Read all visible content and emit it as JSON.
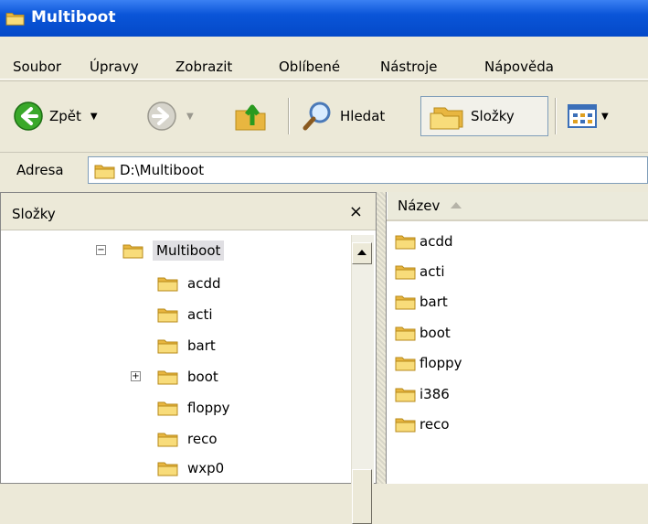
{
  "window": {
    "title": "Multiboot"
  },
  "menu": [
    {
      "label": "Soubor"
    },
    {
      "label": "Úpravy"
    },
    {
      "label": "Zobrazit"
    },
    {
      "label": "Oblíbené"
    },
    {
      "label": "Nástroje"
    },
    {
      "label": "Nápověda"
    }
  ],
  "toolbar": {
    "back_label": "Zpět",
    "search_label": "Hledat",
    "folders_label": "Složky"
  },
  "address": {
    "label": "Adresa",
    "value": "D:\\Multiboot"
  },
  "folders_pane": {
    "title": "Složky",
    "close": "×",
    "tree": [
      {
        "label": "Multiboot"
      },
      {
        "label": "acdd"
      },
      {
        "label": "acti"
      },
      {
        "label": "bart"
      },
      {
        "label": "boot"
      },
      {
        "label": "floppy"
      },
      {
        "label": "reco"
      },
      {
        "label": "wxp0"
      }
    ]
  },
  "files_pane": {
    "column_name": "Název",
    "items": [
      {
        "label": "acdd"
      },
      {
        "label": "acti"
      },
      {
        "label": "bart"
      },
      {
        "label": "boot"
      },
      {
        "label": "floppy"
      },
      {
        "label": "i386"
      },
      {
        "label": "reco"
      }
    ]
  },
  "colors": {
    "title_bar": "#0a55d8",
    "folder": "#f5d46f",
    "window_bg": "#ece9d8"
  }
}
